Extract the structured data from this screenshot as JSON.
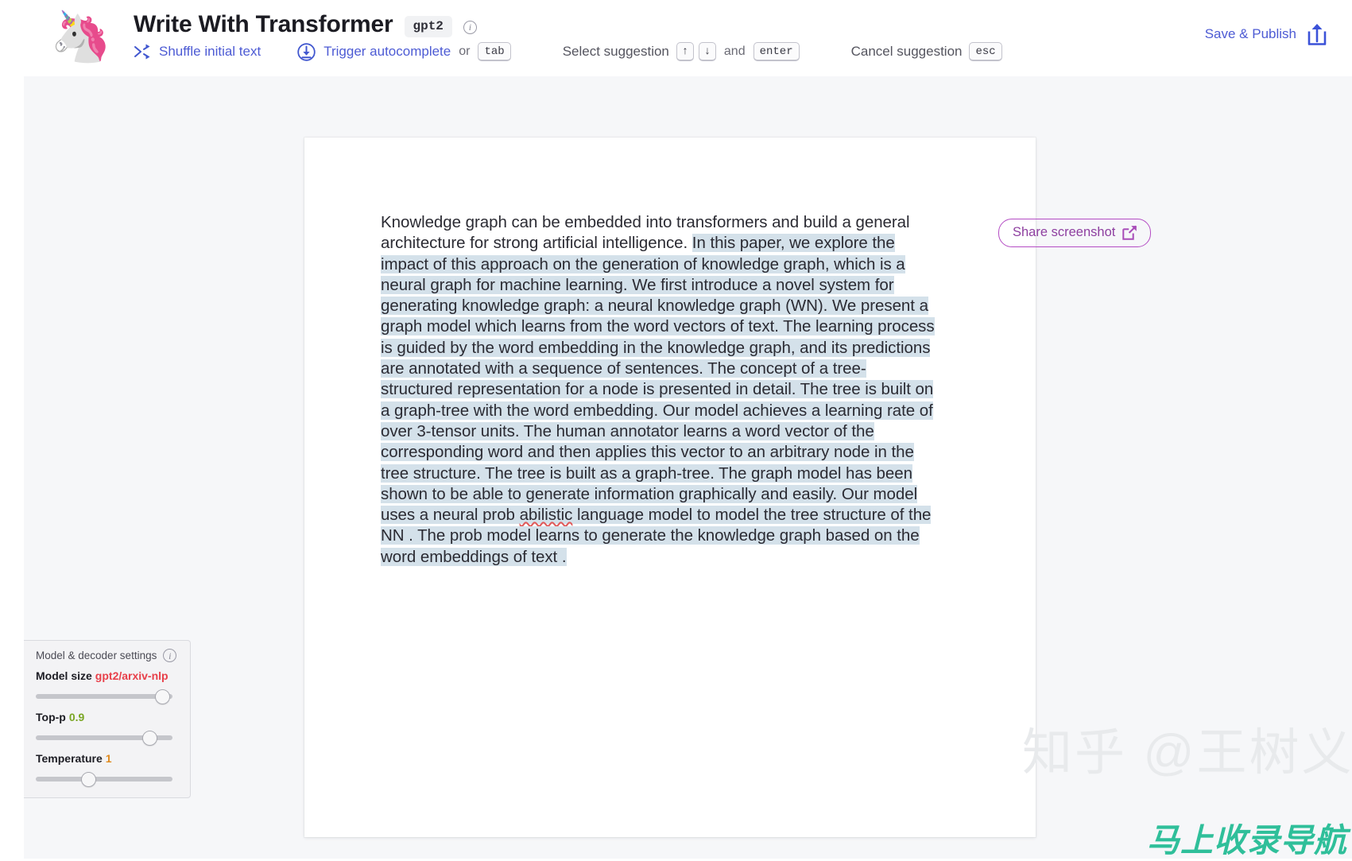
{
  "header": {
    "logo_icon": "unicorn-emoji",
    "logo_glyph": "🦄",
    "title": "Write With Transformer",
    "model_badge": "gpt2",
    "info_icon": "info-icon",
    "info_glyph": "i",
    "toolbar": {
      "shuffle_icon": "shuffle-icon",
      "shuffle_label": "Shuffle initial text",
      "trigger_icon": "download-arrow-icon",
      "trigger_label": "Trigger autocomplete",
      "or_text": "or",
      "tab_key": "tab",
      "select_label": "Select suggestion",
      "arrow_up_key": "↑",
      "arrow_down_key": "↓",
      "and_text": "and",
      "enter_key": "enter",
      "cancel_label": "Cancel suggestion",
      "esc_key": "esc"
    },
    "save_publish_label": "Save & Publish",
    "save_publish_icon": "share-upload-icon"
  },
  "document": {
    "prompt_text": "Knowledge graph can be embedded into transformers and build a general architecture for strong artificial intelligence. ",
    "generated_part_1": "In this paper, we explore the impact of this approach on the generation of knowledge graph, which is a neural graph for machine learning. We first introduce a novel system for generating knowledge graph: a neural knowledge graph (WN).  We present a graph model which learns from the word vectors of text. The learning process is guided by the word embedding in the knowledge graph, and its predictions are annotated with  a sequence of sentences. The concept of a tree-structured representation for a node is presented in detail. The tree is built on a graph-tree with the word embedding. Our model achieves a learning rate of over 3-tensor units. The human annotator learns a word vector of the corresponding  word and then applies this vector to an arbitrary node in the tree structure. The tree is built as a graph-tree. The graph model has been shown to be able to generate information graphically and easily. Our model uses a neural prob ",
    "misspelled_word": "abilistic",
    "generated_part_2": " language model to model the tree structure of the NN . The prob model learns  to generate the knowledge graph based on the word embeddings of text ."
  },
  "share": {
    "label": "Share screenshot",
    "icon": "external-link-icon"
  },
  "settings": {
    "title": "Model & decoder settings",
    "info_icon": "info-icon",
    "info_glyph": "i",
    "rows": [
      {
        "label": "Model size",
        "value": "gpt2/arxiv-nlp",
        "slider_pct": 97
      },
      {
        "label": "Top-p",
        "value": "0.9",
        "slider_pct": 81
      },
      {
        "label": "Temperature",
        "value": "1",
        "slider_pct": 35
      }
    ]
  },
  "watermarks": {
    "zhihu": "知乎 @王树义",
    "nav": "马上收录导航"
  },
  "colors": {
    "accent_blue": "#4d5bd4",
    "highlight": "#d4e1ea",
    "share_purple": "#8e3fa0",
    "model_red": "#e8404a",
    "topp_green": "#7aa624",
    "temp_orange": "#e08a1e",
    "watermark_teal": "#2fbf9a"
  }
}
